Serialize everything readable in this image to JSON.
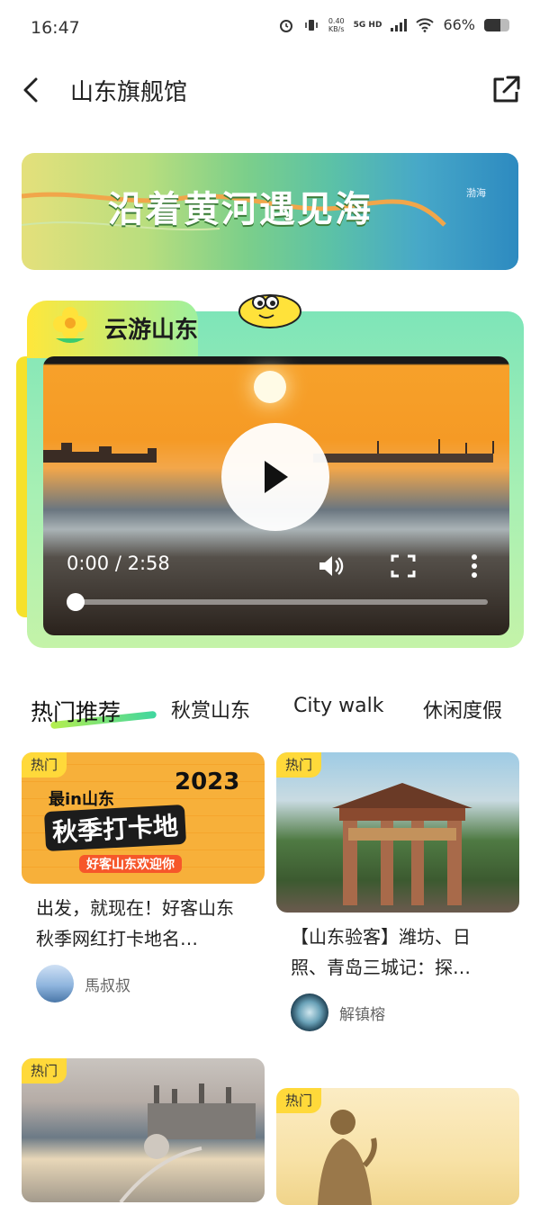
{
  "status_bar": {
    "time": "16:47",
    "net_speed_value": "0.40",
    "net_speed_unit": "KB/s",
    "network": "5G HD",
    "battery": "66%",
    "battery_level": 0.66
  },
  "header": {
    "title": "山东旗舰馆"
  },
  "banner": {
    "text": "沿着黄河遇见海",
    "sea_label": "渤海"
  },
  "cloud_tour": {
    "title": "云游山东",
    "video": {
      "time": "0:00 / 2:58",
      "progress": 0
    }
  },
  "tabs": [
    {
      "label": "热门推荐",
      "active": true
    },
    {
      "label": "秋赏山东",
      "active": false
    },
    {
      "label": "City walk",
      "active": false
    },
    {
      "label": "休闲度假",
      "active": false
    }
  ],
  "cards": [
    {
      "badge": "热门",
      "title": "出发，就现在！好客山东秋季网红打卡地名…",
      "author": "馬叔叔",
      "image_text": {
        "year": "2023",
        "line1": "最in山东",
        "line2": "秋季打卡地",
        "line3": "好客山东欢迎你"
      }
    },
    {
      "badge": "热门",
      "title": "【山东验客】潍坊、日照、青岛三城记：探…",
      "author": "解镇榕"
    },
    {
      "badge": "热门"
    },
    {
      "badge": "热门"
    }
  ],
  "colors": {
    "badge": "#ffd93a",
    "tab_underline": "#3fd6a0",
    "tour_bg": "#a8f0b4"
  }
}
